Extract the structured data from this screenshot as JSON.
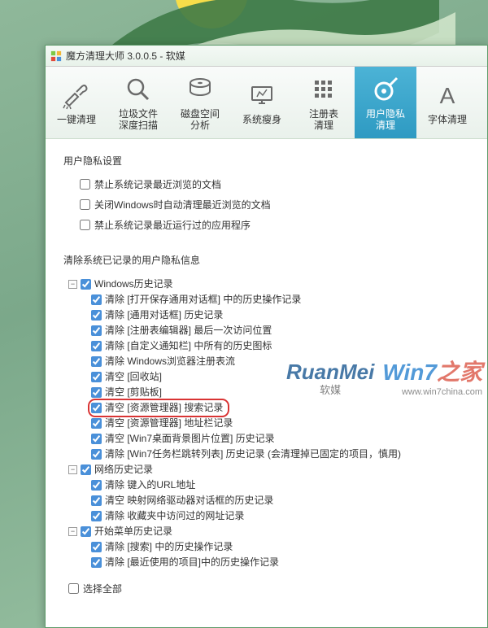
{
  "title": "魔方清理大师 3.0.0.5 - 软媒",
  "toolbar": [
    {
      "label": "一键清理"
    },
    {
      "label": "垃圾文件\n深度扫描"
    },
    {
      "label": "磁盘空间\n分析"
    },
    {
      "label": "系统瘦身"
    },
    {
      "label": "注册表\n清理"
    },
    {
      "label": "用户隐私\n清理"
    },
    {
      "label": "字体清理"
    }
  ],
  "section1": {
    "title": "用户隐私设置",
    "opts": [
      "禁止系统记录最近浏览的文档",
      "关闭Windows时自动清理最近浏览的文档",
      "禁止系统记录最近运行过的应用程序"
    ]
  },
  "section2_title": "清除系统已记录的用户隐私信息",
  "tree": [
    {
      "label": "Windows历史记录",
      "children": [
        "清除 [打开保存通用对话框] 中的历史操作记录",
        "清除 [通用对话框] 历史记录",
        "清除 [注册表编辑器] 最后一次访问位置",
        "清除 [自定义通知栏] 中所有的历史图标",
        "清除 Windows浏览器注册表流",
        "清空 [回收站]",
        "清空 [剪贴板]",
        "清空 [资源管理器] 搜索记录",
        "清空 [资源管理器] 地址栏记录",
        "清空 [Win7桌面背景图片位置] 历史记录",
        "清除 [Win7任务栏跳转列表] 历史记录 (会清理掉已固定的项目，慎用)"
      ],
      "highlight": 7
    },
    {
      "label": "网络历史记录",
      "children": [
        "清除 键入的URL地址",
        "清空 映射网络驱动器对话框的历史记录",
        "清除 收藏夹中访问过的网址记录"
      ]
    },
    {
      "label": "开始菜单历史记录",
      "children": [
        "清除 [搜索] 中的历史操作记录",
        "清除 [最近使用的项目]中的历史操作记录"
      ]
    }
  ],
  "select_all": "选择全部",
  "watermark": {
    "rm": "RuanMei",
    "rm_sub": "软媒",
    "w7_a": "Win7",
    "w7_b": "之家",
    "w7_url": "www.win7china.com"
  }
}
